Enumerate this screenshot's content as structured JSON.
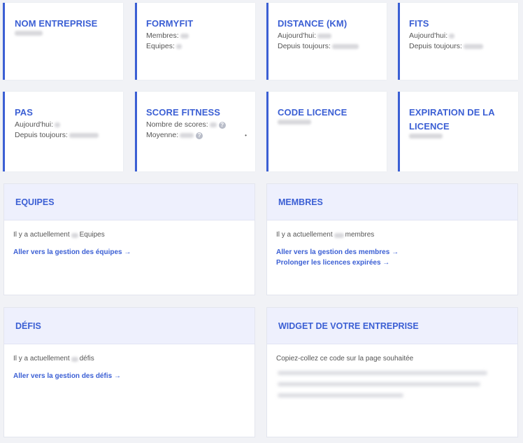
{
  "stats_row1": [
    {
      "title": "NOM ENTREPRISE",
      "lines": []
    },
    {
      "title": "FORMYFIT",
      "lines": [
        {
          "label": "Membres:"
        },
        {
          "label": "Equipes:"
        }
      ]
    },
    {
      "title": "DISTANCE (KM)",
      "lines": [
        {
          "label": "Aujourd'hui:"
        },
        {
          "label": "Depuis toujours:"
        }
      ]
    },
    {
      "title": "FITS",
      "lines": [
        {
          "label": "Aujourd'hui:"
        },
        {
          "label": "Depuis toujours:"
        }
      ]
    }
  ],
  "stats_row2": [
    {
      "title": "PAS",
      "lines": [
        {
          "label": "Aujourd'hui:"
        },
        {
          "label": "Depuis toujours:"
        }
      ]
    },
    {
      "title": "SCORE FITNESS",
      "lines": [
        {
          "label": "Nombre de scores:"
        },
        {
          "label": "Moyenne:"
        }
      ]
    },
    {
      "title": "CODE LICENCE",
      "lines": []
    },
    {
      "title": "EXPIRATION DE LA LICENCE",
      "lines": []
    }
  ],
  "equipes": {
    "title": "EQUIPES",
    "text_prefix": "Il y a actuellement",
    "text_suffix": "Equipes",
    "link": "Aller vers la gestion des équipes →"
  },
  "membres": {
    "title": "MEMBRES",
    "text_prefix": "Il y a actuellement",
    "text_suffix": "membres",
    "link1": "Aller vers la gestion des membres →",
    "link2": "Prolonger les licences expirées →"
  },
  "defis": {
    "title": "DÉFIS",
    "text_prefix": "Il y a actuellement",
    "text_suffix": "défis",
    "link": "Aller vers la gestion des défis →"
  },
  "widget": {
    "title": "WIDGET DE VOTRE ENTREPRISE",
    "text": "Copiez-collez ce code sur la page souhaitée"
  },
  "colors": {
    "accent": "#3b5fd4",
    "panel_header": "#eef0fd",
    "background": "#f1f2f6"
  }
}
